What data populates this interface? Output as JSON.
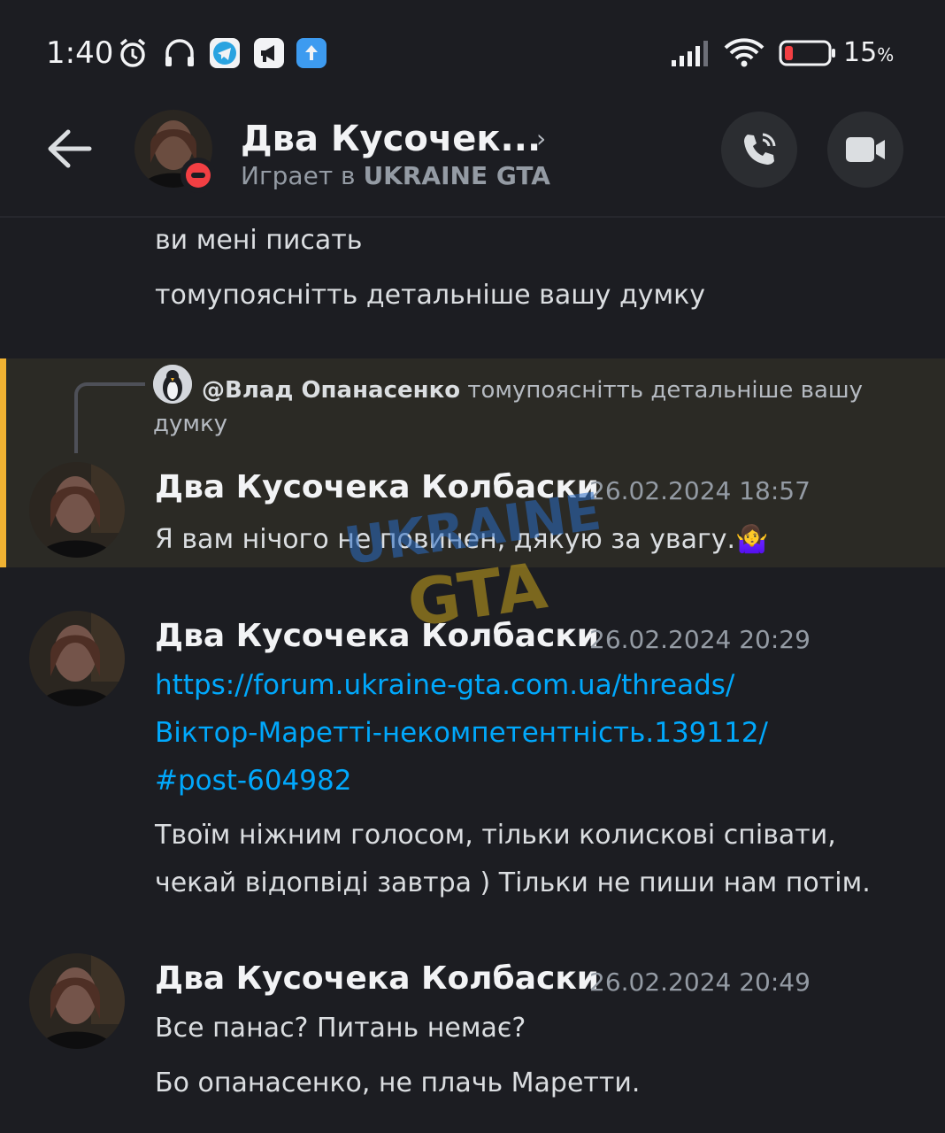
{
  "status_bar": {
    "time": "1:40",
    "battery_percent": "15",
    "battery_unit": "%",
    "icons": [
      "alarm-icon",
      "headphones-icon",
      "telegram-icon",
      "megaphone-app-icon",
      "upload-arrow-icon",
      "signal-icon",
      "wifi-icon",
      "battery-icon"
    ]
  },
  "header": {
    "title": "Два Кусочек...",
    "subtitle_prefix": "Играет в",
    "subtitle_game": "UKRAINE GTA",
    "back_icon": "arrow-left-icon",
    "call_icon": "phone-icon",
    "video_icon": "video-camera-icon",
    "status": "do-not-disturb"
  },
  "previous_lines": [
    "ви мені писать",
    "томупояснітть детальніше вашу думку"
  ],
  "reply": {
    "mention": "@Влад Опанасенко",
    "text_first": "томупояснітть детальніше вашу",
    "text_rest": "думку"
  },
  "messages": [
    {
      "author": "Два Кусочека Колбаски",
      "timestamp": "26.02.2024 18:57",
      "text": "Я вам нічого не повинен, дякую за увагу.",
      "emoji": "🤷‍♀️"
    },
    {
      "author": "Два Кусочека Колбаски",
      "timestamp": "26.02.2024 20:29",
      "link_lines": [
        "https://forum.ukraine-gta.com.ua/threads/",
        "Віктор-Маретті-некомпетентність.139112/",
        "#post-604982"
      ],
      "text_lines": [
        "Твоїм ніжним голосом, тільки колискові співати,",
        "чекай відопвіді завтра ) Тільки не пиши нам потім."
      ]
    },
    {
      "author": "Два Кусочека Колбаски",
      "timestamp": "26.02.2024 20:49",
      "text_lines": [
        "Все панас? Питань немає?",
        "Бо опанасенко, не плачь Маретти."
      ]
    }
  ],
  "watermark": {
    "line1": "UKRAINE",
    "line2": "GTA"
  },
  "colors": {
    "background": "#1c1d22",
    "highlight": "#2b2a25",
    "highlight_bar": "#f0b232",
    "link": "#00a8fc",
    "dnd": "#f23f43"
  }
}
